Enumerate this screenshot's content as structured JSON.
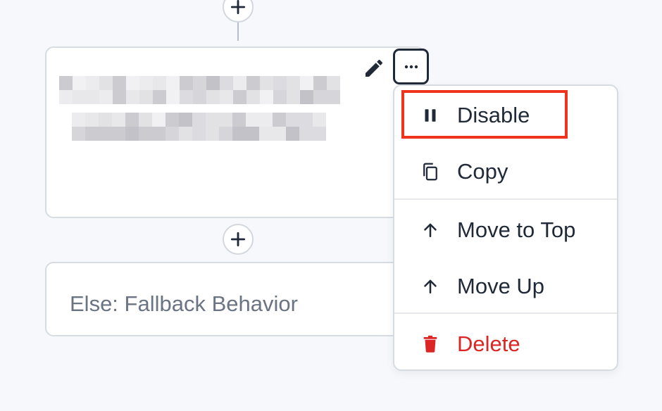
{
  "flow": {
    "add_step_icon": "plus-icon",
    "else_label": "Else: Fallback Behavior"
  },
  "rule_card": {
    "edit_icon": "pencil-icon",
    "more_icon": "ellipsis-icon"
  },
  "menu": {
    "items": [
      {
        "label": "Disable",
        "icon": "pause-icon"
      },
      {
        "label": "Copy",
        "icon": "copy-icon"
      },
      {
        "label": "Move to Top",
        "icon": "arrow-up-icon"
      },
      {
        "label": "Move Up",
        "icon": "arrow-up-icon"
      },
      {
        "label": "Delete",
        "icon": "trash-icon"
      }
    ]
  },
  "colors": {
    "danger": "#dc2626",
    "highlight": "#f0331c",
    "text": "#1f2937",
    "muted": "#6b7482"
  }
}
